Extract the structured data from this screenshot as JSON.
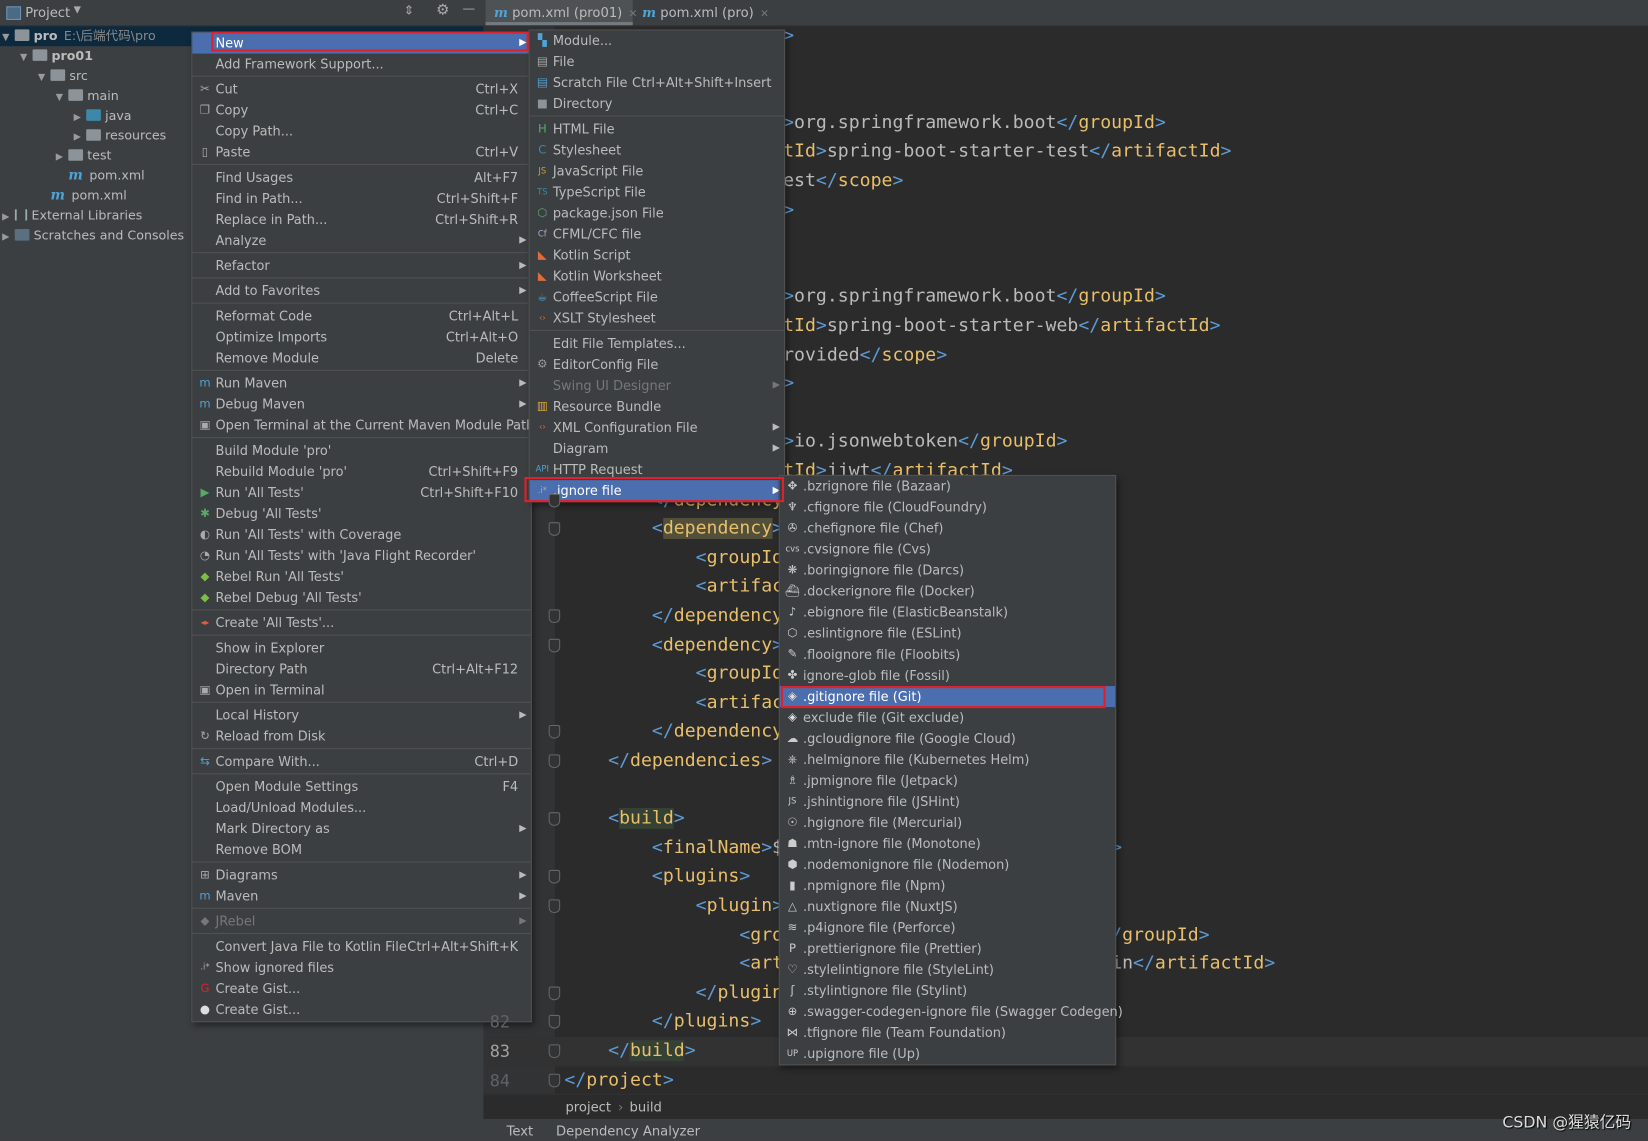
{
  "project_panel": {
    "title": "Project",
    "tree": [
      {
        "label": "pro",
        "hint": "E:\\后端代码\\pro",
        "icon": "module-folder",
        "depth": 0,
        "expanded": true,
        "selected": true,
        "bold": true
      },
      {
        "label": "pro01",
        "icon": "module-folder",
        "depth": 1,
        "expanded": true,
        "bold": true
      },
      {
        "label": "src",
        "icon": "folder",
        "depth": 2,
        "expanded": true
      },
      {
        "label": "main",
        "icon": "folder",
        "depth": 3,
        "expanded": true
      },
      {
        "label": "java",
        "icon": "source-folder",
        "depth": 4,
        "expanded": false
      },
      {
        "label": "resources",
        "icon": "resources-folder",
        "depth": 4,
        "expanded": false
      },
      {
        "label": "test",
        "icon": "folder",
        "depth": 3,
        "expanded": false
      },
      {
        "label": "pom.xml",
        "icon": "maven",
        "depth": 3,
        "leaf": true
      },
      {
        "label": "pom.xml",
        "icon": "maven",
        "depth": 2,
        "leaf": true
      },
      {
        "label": "External Libraries",
        "icon": "library",
        "depth": 0,
        "expanded": false
      },
      {
        "label": "Scratches and Consoles",
        "icon": "scratches",
        "depth": 0,
        "expanded": false
      }
    ]
  },
  "tabs": [
    {
      "label": "pom.xml (pro01)",
      "active": true
    },
    {
      "label": "pom.xml (pro)",
      "active": false
    }
  ],
  "editor": {
    "lines": [
      {
        "n": "",
        "text": "                    >"
      },
      {
        "n": "",
        "text": ""
      },
      {
        "n": "",
        "text": ""
      },
      {
        "n": "",
        "text": "                    >org.springframework.boot</groupId>"
      },
      {
        "n": "",
        "text": "                    tId>spring-boot-starter-test</artifactId>"
      },
      {
        "n": "",
        "text": "                    est</scope>"
      },
      {
        "n": "",
        "text": "                    >"
      },
      {
        "n": "",
        "text": ""
      },
      {
        "n": "",
        "text": ""
      },
      {
        "n": "",
        "text": "                    >org.springframework.boot</groupId>"
      },
      {
        "n": "",
        "text": "                    tId>spring-boot-starter-web</artifactId>"
      },
      {
        "n": "",
        "text": "                    rovided</scope>"
      },
      {
        "n": "",
        "text": "                    >"
      },
      {
        "n": "",
        "text": ""
      },
      {
        "n": "",
        "text": "                    >io.jsonwebtoken</groupId>"
      },
      {
        "n": "",
        "text": "                    tId>jjwt</artifactId>"
      },
      {
        "n": "",
        "text": "        </dependency>"
      },
      {
        "n": "",
        "text": "        <dependency>"
      },
      {
        "n": "",
        "text": "            <groupId>"
      },
      {
        "n": "",
        "text": "            <artifactId>"
      },
      {
        "n": "",
        "text": "        </dependency>"
      },
      {
        "n": "",
        "text": "        <dependency>"
      },
      {
        "n": "",
        "text": "            <groupId>"
      },
      {
        "n": "",
        "text": "            <artifactId>"
      },
      {
        "n": "",
        "text": "        </dependency>"
      },
      {
        "n": "",
        "text": "    </dependencies>"
      },
      {
        "n": "",
        "text": ""
      },
      {
        "n": "",
        "text": "    <build>"
      },
      {
        "n": "",
        "text": "        <finalName>$                             e>"
      },
      {
        "n": "",
        "text": "        <plugins>"
      },
      {
        "n": "",
        "text": "            <plugin>"
      },
      {
        "n": "",
        "text": "                <gro                             </groupId>"
      },
      {
        "n": "",
        "text": "                <art                              in</artifactId>"
      },
      {
        "n": "",
        "text": "            </plugin>"
      },
      {
        "n": "82",
        "text": "        </plugins>"
      },
      {
        "n": "83",
        "text": "    </build>"
      },
      {
        "n": "84",
        "text": "</project>"
      }
    ],
    "breadcrumb": [
      "project",
      "build"
    ],
    "bottom_tabs": [
      "Text",
      "Dependency Analyzer"
    ]
  },
  "context_menu": [
    {
      "label": "New",
      "arrow": true,
      "selected": true
    },
    {
      "label": "Add Framework Support..."
    },
    {
      "sep": true
    },
    {
      "label": "Cut",
      "shortcut": "Ctrl+X",
      "icon": "scissors"
    },
    {
      "label": "Copy",
      "shortcut": "Ctrl+C",
      "icon": "copy"
    },
    {
      "label": "Copy Path..."
    },
    {
      "label": "Paste",
      "shortcut": "Ctrl+V",
      "icon": "clipboard"
    },
    {
      "sep": true
    },
    {
      "label": "Find Usages",
      "shortcut": "Alt+F7"
    },
    {
      "label": "Find in Path...",
      "shortcut": "Ctrl+Shift+F"
    },
    {
      "label": "Replace in Path...",
      "shortcut": "Ctrl+Shift+R"
    },
    {
      "label": "Analyze",
      "arrow": true
    },
    {
      "sep": true
    },
    {
      "label": "Refactor",
      "arrow": true
    },
    {
      "sep": true
    },
    {
      "label": "Add to Favorites",
      "arrow": true
    },
    {
      "sep": true
    },
    {
      "label": "Reformat Code",
      "shortcut": "Ctrl+Alt+L"
    },
    {
      "label": "Optimize Imports",
      "shortcut": "Ctrl+Alt+O"
    },
    {
      "label": "Remove Module",
      "shortcut": "Delete"
    },
    {
      "sep": true
    },
    {
      "label": "Run Maven",
      "arrow": true,
      "icon": "maven-run"
    },
    {
      "label": "Debug Maven",
      "arrow": true,
      "icon": "maven-debug"
    },
    {
      "label": "Open Terminal at the Current Maven Module Path",
      "icon": "terminal"
    },
    {
      "sep": true
    },
    {
      "label": "Build Module 'pro'"
    },
    {
      "label": "Rebuild Module 'pro'",
      "shortcut": "Ctrl+Shift+F9"
    },
    {
      "label": "Run 'All Tests'",
      "shortcut": "Ctrl+Shift+F10",
      "icon": "run"
    },
    {
      "label": "Debug 'All Tests'",
      "icon": "debug"
    },
    {
      "label": "Run 'All Tests' with Coverage",
      "icon": "coverage"
    },
    {
      "label": "Run 'All Tests' with 'Java Flight Recorder'",
      "icon": "flight-recorder"
    },
    {
      "label": "Rebel Run 'All Tests'",
      "icon": "jrebel-run"
    },
    {
      "label": "Rebel Debug 'All Tests'",
      "icon": "jrebel-debug"
    },
    {
      "sep": true
    },
    {
      "label": "Create 'All Tests'...",
      "icon": "create-test"
    },
    {
      "sep": true
    },
    {
      "label": "Show in Explorer"
    },
    {
      "label": "Directory Path",
      "shortcut": "Ctrl+Alt+F12"
    },
    {
      "label": "Open in Terminal",
      "icon": "terminal"
    },
    {
      "sep": true
    },
    {
      "label": "Local History",
      "arrow": true
    },
    {
      "label": "Reload from Disk",
      "icon": "reload"
    },
    {
      "sep": true
    },
    {
      "label": "Compare With...",
      "shortcut": "Ctrl+D",
      "icon": "compare"
    },
    {
      "sep": true
    },
    {
      "label": "Open Module Settings",
      "shortcut": "F4"
    },
    {
      "label": "Load/Unload Modules..."
    },
    {
      "label": "Mark Directory as",
      "arrow": true
    },
    {
      "label": "Remove BOM"
    },
    {
      "sep": true
    },
    {
      "label": "Diagrams",
      "arrow": true,
      "icon": "diagram"
    },
    {
      "label": "Maven",
      "arrow": true,
      "icon": "maven"
    },
    {
      "sep": true
    },
    {
      "label": "JRebel",
      "arrow": true,
      "disabled": true,
      "icon": "jrebel"
    },
    {
      "sep": true
    },
    {
      "label": "Convert Java File to Kotlin File",
      "shortcut": "Ctrl+Alt+Shift+K"
    },
    {
      "label": "Show ignored files",
      "icon": "ignore"
    },
    {
      "label": "Create Gist...",
      "icon": "gitee"
    },
    {
      "label": "Create Gist...",
      "icon": "github"
    }
  ],
  "new_submenu": [
    {
      "label": "Module...",
      "icon": "module"
    },
    {
      "label": "File",
      "icon": "file"
    },
    {
      "label": "Scratch File",
      "shortcut": "Ctrl+Alt+Shift+Insert",
      "icon": "scratch-file"
    },
    {
      "label": "Directory",
      "icon": "folder"
    },
    {
      "sep": true
    },
    {
      "label": "HTML File",
      "icon": "html-file"
    },
    {
      "label": "Stylesheet",
      "icon": "css-file"
    },
    {
      "label": "JavaScript File",
      "icon": "js-file"
    },
    {
      "label": "TypeScript File",
      "icon": "ts-file"
    },
    {
      "label": "package.json File",
      "icon": "nodejs"
    },
    {
      "label": "CFML/CFC file",
      "icon": "cfml"
    },
    {
      "label": "Kotlin Script",
      "icon": "kotlin"
    },
    {
      "label": "Kotlin Worksheet",
      "icon": "kotlin"
    },
    {
      "label": "CoffeeScript File",
      "icon": "coffeescript"
    },
    {
      "label": "XSLT Stylesheet",
      "icon": "xslt"
    },
    {
      "sep": true
    },
    {
      "label": "Edit File Templates..."
    },
    {
      "label": "EditorConfig File",
      "icon": "gear"
    },
    {
      "label": "Swing UI Designer",
      "arrow": true,
      "disabled": true
    },
    {
      "label": "Resource Bundle",
      "icon": "resource-bundle"
    },
    {
      "label": "XML Configuration File",
      "arrow": true,
      "icon": "xml-file"
    },
    {
      "label": "Diagram",
      "arrow": true
    },
    {
      "label": "HTTP Request",
      "icon": "api"
    },
    {
      "label": ".ignore file",
      "arrow": true,
      "selected": true,
      "icon": "ignore"
    }
  ],
  "ignore_submenu": [
    {
      "label": ".bzrignore file (Bazaar)",
      "icon": "bazaar"
    },
    {
      "label": ".cfignore file (CloudFoundry)",
      "icon": "cloudfoundry"
    },
    {
      "label": ".chefignore file (Chef)",
      "icon": "chef"
    },
    {
      "label": ".cvsignore file (Cvs)",
      "icon": "cvs"
    },
    {
      "label": ".boringignore file (Darcs)",
      "icon": "darcs"
    },
    {
      "label": ".dockerignore file (Docker)",
      "icon": "docker"
    },
    {
      "label": ".ebignore file (ElasticBeanstalk)",
      "icon": "elasticbeanstalk"
    },
    {
      "label": ".eslintignore file (ESLint)",
      "icon": "eslint"
    },
    {
      "label": ".flooignore file (Floobits)",
      "icon": "floobits"
    },
    {
      "label": "ignore-glob file (Fossil)",
      "icon": "fossil"
    },
    {
      "label": ".gitignore file (Git)",
      "icon": "git",
      "selected": true
    },
    {
      "label": "exclude file (Git exclude)",
      "icon": "git"
    },
    {
      "label": ".gcloudignore file (Google Cloud)",
      "icon": "google-cloud"
    },
    {
      "label": ".helmignore file (Kubernetes Helm)",
      "icon": "helm"
    },
    {
      "label": ".jpmignore file (Jetpack)",
      "icon": "jetpack"
    },
    {
      "label": ".jshintignore file (JSHint)",
      "icon": "jshint"
    },
    {
      "label": ".hgignore file (Mercurial)",
      "icon": "mercurial"
    },
    {
      "label": ".mtn-ignore file (Monotone)",
      "icon": "monotone"
    },
    {
      "label": ".nodemonignore file (Nodemon)",
      "icon": "nodemon"
    },
    {
      "label": ".npmignore file (Npm)",
      "icon": "npm"
    },
    {
      "label": ".nuxtignore file (NuxtJS)",
      "icon": "nuxt"
    },
    {
      "label": ".p4ignore file (Perforce)",
      "icon": "perforce"
    },
    {
      "label": ".prettierignore file (Prettier)",
      "icon": "prettier"
    },
    {
      "label": ".stylelintignore file (StyleLint)",
      "icon": "stylelint"
    },
    {
      "label": ".stylintignore file (Stylint)",
      "icon": "stylint"
    },
    {
      "label": ".swagger-codegen-ignore file (Swagger Codegen)",
      "icon": "swagger"
    },
    {
      "label": ".tfignore file (Team Foundation)",
      "icon": "team-foundation"
    },
    {
      "label": ".upignore file (Up)",
      "icon": "up"
    }
  ],
  "watermark": "CSDN @猩猿亿码",
  "colors": {
    "menu_bg": "#3c3f41",
    "selection": "#4b6eaf",
    "annotation_box": "#e0202a",
    "tag": "#e8bf6a",
    "bracket": "#5c9bd6"
  }
}
